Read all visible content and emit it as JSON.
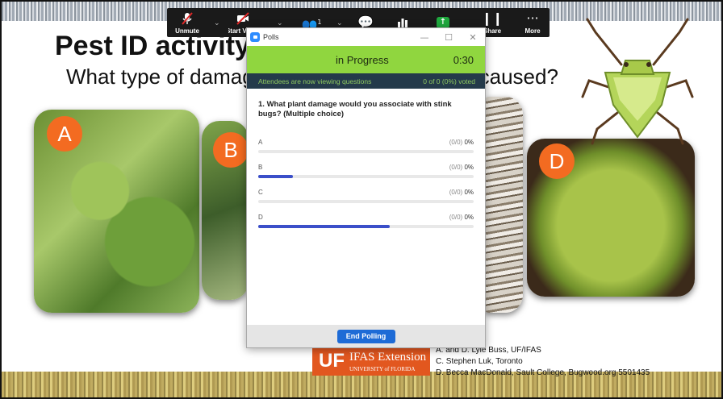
{
  "slide": {
    "title": "Pest ID activity",
    "question": "What type of damage could stink bugs have caused?",
    "badges": [
      "A",
      "B",
      "D"
    ],
    "logo": {
      "uf": "UF",
      "ext_main": "IFAS Extension",
      "ext_sub": "UNIVERSITY of FLORIDA"
    },
    "credits": [
      "A. and D. Lyle Buss, UF/IFAS",
      "C. Stephen Luk, Toronto",
      "D. Becca MacDonald, Sault College, Bugwood.org 5501435"
    ]
  },
  "toolbar": {
    "unmute_label": "Unmute",
    "start_video_label": "Start Video",
    "participants_count": "1",
    "share_label": "Share",
    "more_label": "More",
    "icons": [
      "microphone-muted-icon",
      "video-off-icon",
      "participants-icon",
      "chat-icon",
      "polls-icon",
      "share-screen-icon",
      "pause-share-icon",
      "more-icon"
    ],
    "share_accent": "#1fa93e"
  },
  "polls": {
    "window_title": "Polls",
    "status": "in Progress",
    "timer": "0:30",
    "viewing_text": "Attendees are now viewing questions",
    "voted_text": "0 of 0 (0%) voted",
    "question_number": "1.",
    "question": "What plant damage would you associate with stink bugs? (Multiple choice)",
    "options": [
      {
        "label": "A",
        "count": "(0/0)",
        "percent": "0%",
        "fill": 0.0
      },
      {
        "label": "B",
        "count": "(0/0)",
        "percent": "0%",
        "fill": 0.16
      },
      {
        "label": "C",
        "count": "(0/0)",
        "percent": "0%",
        "fill": 0.0
      },
      {
        "label": "D",
        "count": "(0/0)",
        "percent": "0%",
        "fill": 0.61
      }
    ],
    "end_button": "End Polling",
    "status_color": "#90d63f",
    "bar_color": "#3b4fc9",
    "button_color": "#1e6bd6"
  }
}
